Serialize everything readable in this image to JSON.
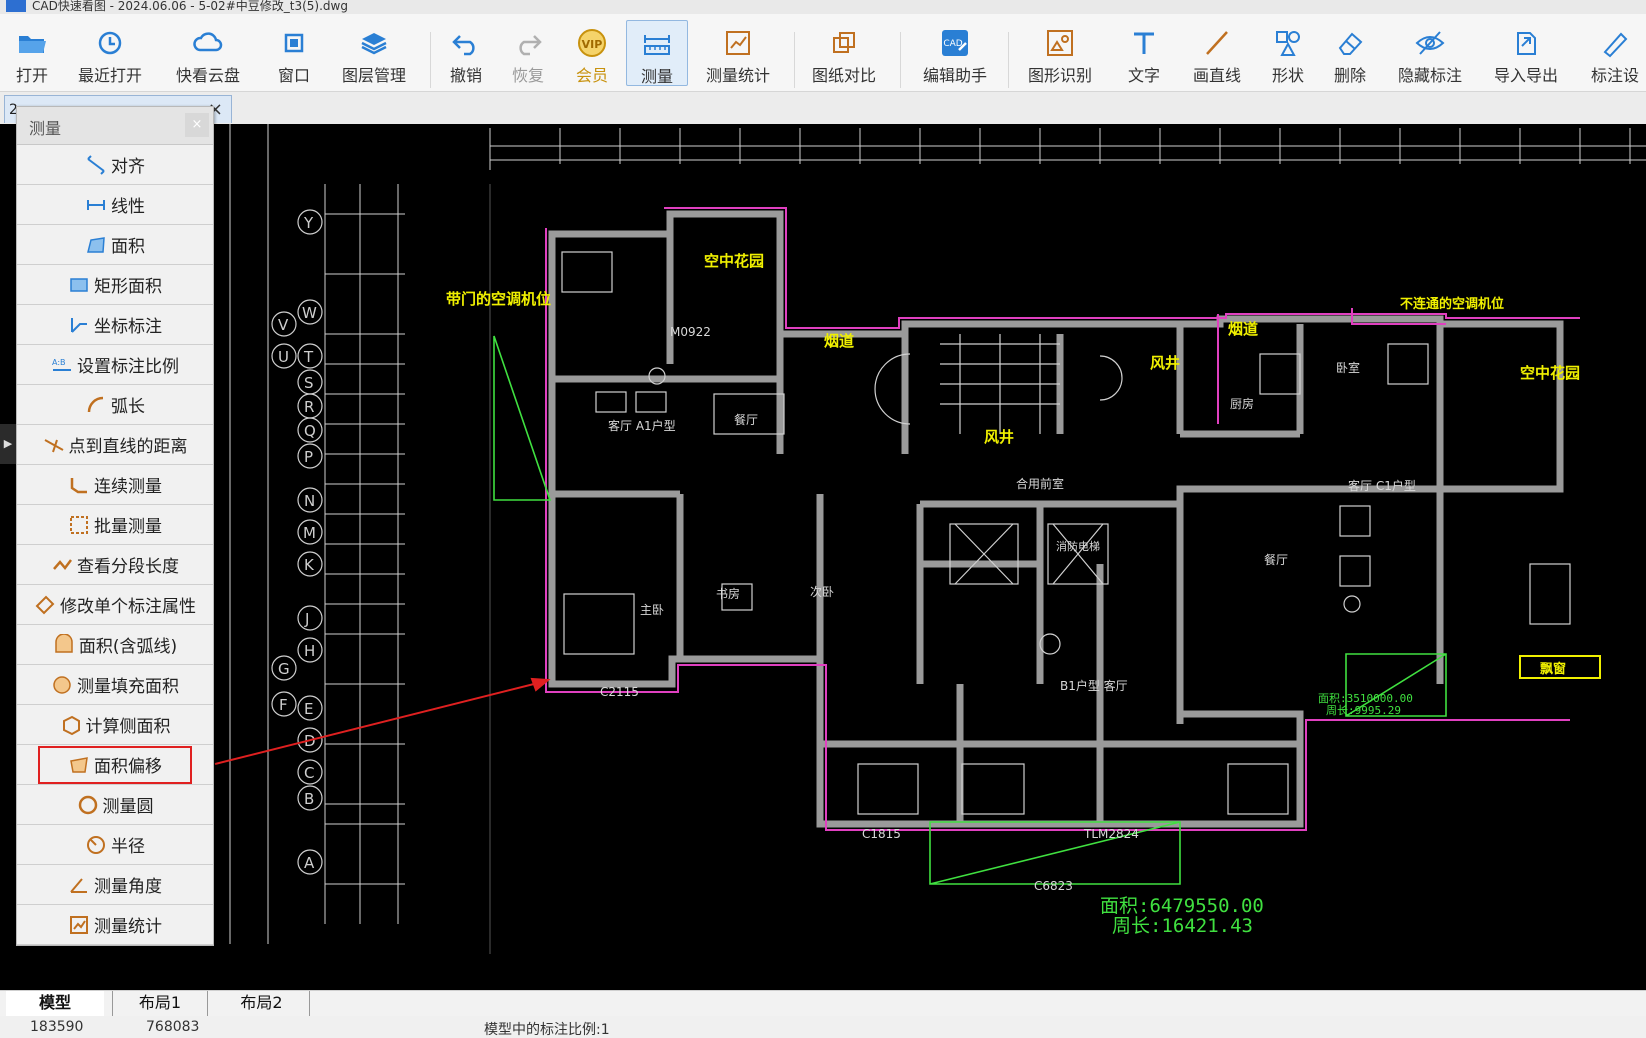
{
  "app": {
    "title": "CAD快速看图 - 2024.06.06 - 5-02#中豆修改_t3(5).dwg"
  },
  "toolbar": {
    "items": [
      {
        "label": "打开",
        "icon": "folder-open-icon"
      },
      {
        "label": "最近打开",
        "icon": "recent-clock-icon"
      },
      {
        "label": "快看云盘",
        "icon": "cloud-icon"
      },
      {
        "label": "窗口",
        "icon": "window-icon"
      },
      {
        "label": "图层管理",
        "icon": "layers-icon"
      },
      {
        "label": "撤销",
        "icon": "undo-icon"
      },
      {
        "label": "恢复",
        "icon": "redo-icon"
      },
      {
        "label": "会员",
        "icon": "vip-badge-icon"
      },
      {
        "label": "测量",
        "icon": "measure-ruler-icon"
      },
      {
        "label": "测量统计",
        "icon": "measure-stats-icon"
      },
      {
        "label": "图纸对比",
        "icon": "compare-icon"
      },
      {
        "label": "编辑助手",
        "icon": "cad-edit-icon"
      },
      {
        "label": "图形识别",
        "icon": "shape-recognize-icon"
      },
      {
        "label": "文字",
        "icon": "text-t-icon"
      },
      {
        "label": "画直线",
        "icon": "line-icon"
      },
      {
        "label": "形状",
        "icon": "shapes-icon"
      },
      {
        "label": "删除",
        "icon": "eraser-icon"
      },
      {
        "label": "隐藏标注",
        "icon": "eye-hidden-icon"
      },
      {
        "label": "导入导出",
        "icon": "import-export-icon"
      },
      {
        "label": "标注设",
        "icon": "annotation-settings-icon"
      }
    ],
    "active_index": 8,
    "colors": {
      "icon_blue": "#2a7fd4",
      "vip_gold": "#d4a017",
      "active_bg": "#e1edf9"
    }
  },
  "doc_tab": {
    "label": "2"
  },
  "panel": {
    "title": "测量",
    "close": "×",
    "items": [
      {
        "label": "对齐",
        "icon": "align-measure-icon"
      },
      {
        "label": "线性",
        "icon": "linear-measure-icon"
      },
      {
        "label": "面积",
        "icon": "area-icon"
      },
      {
        "label": "矩形面积",
        "icon": "rect-area-icon"
      },
      {
        "label": "坐标标注",
        "icon": "coordinate-icon"
      },
      {
        "label": "设置标注比例",
        "icon": "scale-ab-icon"
      },
      {
        "label": "弧长",
        "icon": "arc-length-icon"
      },
      {
        "label": "点到直线的距离",
        "icon": "point-line-distance-icon"
      },
      {
        "label": "连续测量",
        "icon": "continuous-measure-icon"
      },
      {
        "label": "批量测量",
        "icon": "batch-measure-icon"
      },
      {
        "label": "查看分段长度",
        "icon": "segment-length-icon"
      },
      {
        "label": "修改单个标注属性",
        "icon": "edit-annotation-icon"
      },
      {
        "label": "面积(含弧线)",
        "icon": "arc-area-icon"
      },
      {
        "label": "测量填充面积",
        "icon": "fill-area-icon"
      },
      {
        "label": "计算侧面积",
        "icon": "side-area-icon"
      },
      {
        "label": "面积偏移",
        "icon": "area-offset-icon"
      },
      {
        "label": "测量圆",
        "icon": "circle-measure-icon"
      },
      {
        "label": "半径",
        "icon": "radius-icon"
      },
      {
        "label": "测量角度",
        "icon": "angle-icon"
      },
      {
        "label": "测量统计",
        "icon": "measure-stats-icon"
      }
    ],
    "highlighted_index": 15,
    "highlight_color": "#e02020"
  },
  "drawing": {
    "labels": {
      "garden_left": "空中花园",
      "garden_right": "空中花园",
      "ac_door": "带门的空调机位",
      "ac_blocked": "不连通的空调机位",
      "wind_shaft": "风井",
      "wind_shaft2": "风井",
      "flue": "烟道",
      "flue2": "烟道",
      "living_a1": "客厅  A1户型",
      "living_c1": "客厅  C1户型",
      "b1": "B1户型  客厅",
      "dining": "餐厅",
      "dining2": "餐厅",
      "kitchen": "厨房",
      "bedroom": "卧室",
      "master": "主卧",
      "study": "书房",
      "second": "次卧",
      "lobby": "合用前室",
      "elevator": "消防电梯",
      "bay_window": "飘窗",
      "c2115": "C2115",
      "c6823": "C6823",
      "c1815": "C1815",
      "tlm2824": "TLM2824",
      "m0922": "M0922"
    },
    "measurement": {
      "area": "面积:6479550.00",
      "perimeter": "周长:16421.43",
      "small_area": "面积:3510000.00",
      "small_perimeter": "周长:9995.29"
    },
    "axis_labels": [
      "Y",
      "W",
      "V",
      "U",
      "T",
      "S",
      "R",
      "Q",
      "P",
      "N",
      "M",
      "K",
      "J",
      "H",
      "G",
      "F",
      "E",
      "D",
      "C",
      "B",
      "A"
    ],
    "colors": {
      "wall": "#9a9a9a",
      "outline": "#e040c0",
      "label": "#f0f000",
      "measure": "#40e040",
      "arrow": "#e02020",
      "lines": "#d0d0d0"
    }
  },
  "layout_tabs": [
    {
      "label": "模型"
    },
    {
      "label": "布局1"
    },
    {
      "label": "布局2"
    }
  ],
  "status": {
    "x": "183590",
    "y": "768083",
    "message": "模型中的标注比例:1"
  }
}
